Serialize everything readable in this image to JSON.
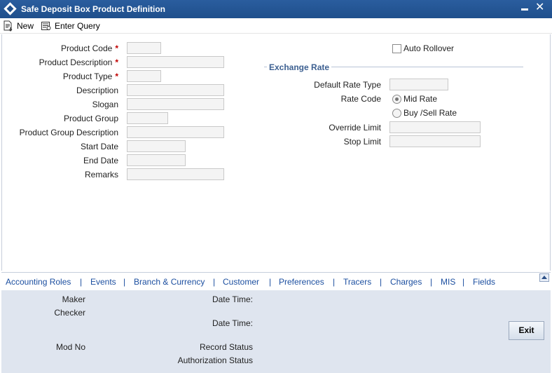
{
  "window": {
    "title": "Safe Deposit Box Product Definition"
  },
  "toolbar": {
    "new_label": "New",
    "enter_query_label": "Enter Query"
  },
  "form": {
    "product_code": "Product Code",
    "product_description": "Product Description",
    "product_type": "Product Type",
    "description": "Description",
    "slogan": "Slogan",
    "product_group": "Product Group",
    "product_group_description": "Product Group Description",
    "start_date": "Start Date",
    "end_date": "End Date",
    "remarks": "Remarks",
    "required_marker": "*"
  },
  "right": {
    "auto_rollover": "Auto Rollover",
    "exchange_rate_title": "Exchange Rate",
    "default_rate_type": "Default Rate Type",
    "rate_code": "Rate Code",
    "mid_rate": "Mid Rate",
    "buy_sell_rate": "Buy /Sell Rate",
    "override_limit": "Override Limit",
    "stop_limit": "Stop Limit"
  },
  "tabs": [
    "Accounting Roles",
    "Events",
    "Branch & Currency",
    "Customer",
    "Preferences",
    "Tracers",
    "Charges",
    "MIS",
    "Fields"
  ],
  "tab_separator": "|",
  "footer": {
    "maker": "Maker",
    "checker": "Checker",
    "date_time": "Date Time:",
    "mod_no": "Mod No",
    "record_status": "Record Status",
    "authorization_status": "Authorization Status",
    "exit_label": "Exit"
  }
}
